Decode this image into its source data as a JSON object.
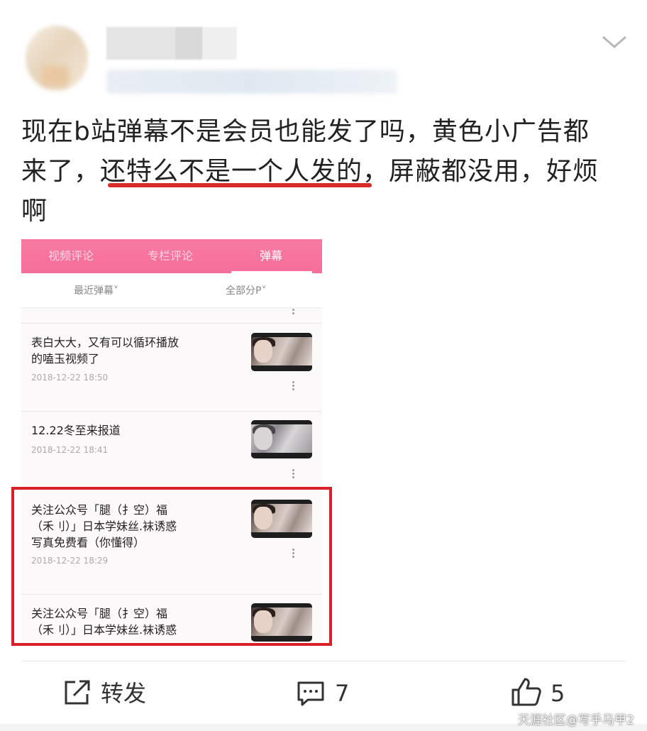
{
  "post": {
    "line1": "现在b站弹幕不是会员也能发了吗，黄色小广告都",
    "line2_pre": "来了，",
    "line2_underlined": "还特么不是一个人发的",
    "line2_post": "，屏蔽都没用，好烦",
    "line3": "啊"
  },
  "embedded": {
    "tabs": [
      "视频评论",
      "专栏评论",
      "弹幕"
    ],
    "active_tab": "弹幕",
    "filter_left": "最近弹幕˅",
    "filter_right": "全部分P˅",
    "items": [
      {
        "text": "表白大大，又有可以循环播放的嗑玉视频了",
        "line1": "表白大大，又有可以循环播放",
        "line2": "的嗑玉视频了",
        "date": "2018-12-22 18:50"
      },
      {
        "text": "12.22冬至来报道",
        "line1": "12.22冬至来报道",
        "date": "2018-12-22 18:41"
      },
      {
        "line1": "关注公众号「腿（扌空）福",
        "line2": "（禾刂）」日本学妹丝.袜诱惑",
        "line3": "写真免费看（你懂得）",
        "date": "2018-12-22 18:29"
      },
      {
        "line1": "关注公众号「腿（扌空）福",
        "line2": "（禾刂）」日本学妹丝.袜诱惑"
      }
    ]
  },
  "actions": {
    "repost": "转发",
    "comments": "7",
    "likes": "5"
  },
  "watermark": "天涯社区@写手马甲2",
  "colors": {
    "accent_pink": "#f46e99",
    "highlight_red": "#d91f27"
  }
}
